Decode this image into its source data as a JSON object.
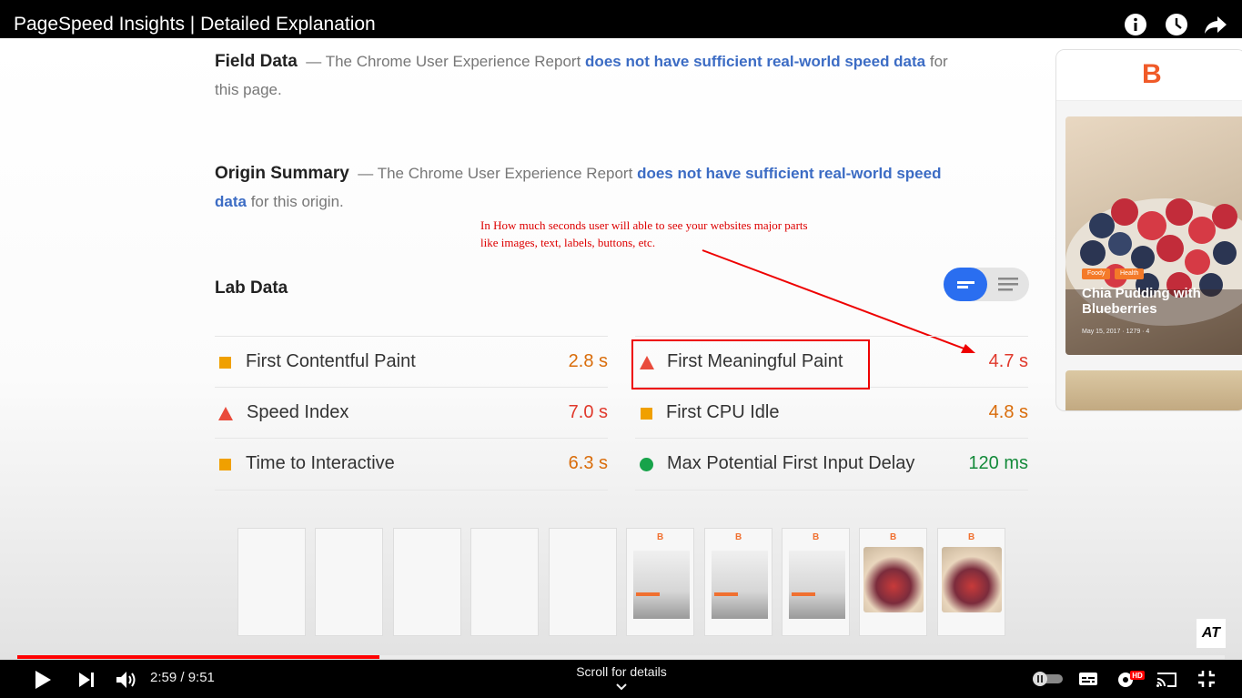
{
  "video": {
    "title": "PageSpeed Insights | Detailed Explanation"
  },
  "field_data": {
    "heading": "Field Data",
    "dash": "—",
    "text_before": "The Chrome User Experience Report",
    "link": "does not have sufficient real-world speed data",
    "text_after": "for this page."
  },
  "origin_summary": {
    "heading": "Origin Summary",
    "dash": "—",
    "text_before": "The Chrome User Experience Report",
    "link": "does not have sufficient real-world speed data",
    "text_after": "for this origin."
  },
  "annotation": {
    "line1": "In How much seconds user will able to see your websites major parts",
    "line2": "like images, text, labels, buttons, etc."
  },
  "lab_data": {
    "title": "Lab Data",
    "metrics": [
      {
        "label": "First Contentful Paint",
        "value": "2.8 s",
        "indicator": "square",
        "color": "#d96c0a"
      },
      {
        "label": "First Meaningful Paint",
        "value": "4.7 s",
        "indicator": "triangle",
        "color": "#e0392c"
      },
      {
        "label": "Speed Index",
        "value": "7.0 s",
        "indicator": "triangle",
        "color": "#e0392c"
      },
      {
        "label": "First CPU Idle",
        "value": "4.8 s",
        "indicator": "square",
        "color": "#d96c0a"
      },
      {
        "label": "Time to Interactive",
        "value": "6.3 s",
        "indicator": "square",
        "color": "#d96c0a"
      },
      {
        "label": "Max Potential First Input Delay",
        "value": "120 ms",
        "indicator": "circle",
        "color": "#148a3a"
      }
    ]
  },
  "phone_preview": {
    "logo": "B",
    "card_title": "Chia Pudding with Blueberries",
    "tags": [
      "Foody",
      "Health"
    ],
    "meta": "May 15, 2017  ·  1279  ·  4"
  },
  "filmstrip": {
    "logo": "B"
  },
  "watermark": "AT",
  "player": {
    "time": "2:59 / 9:51",
    "progress": 0.3,
    "scroll_label": "Scroll for details",
    "hd_badge": "HD"
  },
  "icons": {
    "info": "info-icon",
    "watch_later": "clock-icon",
    "share": "share-icon",
    "play": "play-icon",
    "next": "next-icon",
    "volume": "volume-icon",
    "autoplay": "autoplay-toggle-icon",
    "subtitles": "subtitles-icon",
    "settings": "gear-icon",
    "cast": "cast-icon",
    "fullscreen_exit": "fullscreen-exit-icon"
  }
}
